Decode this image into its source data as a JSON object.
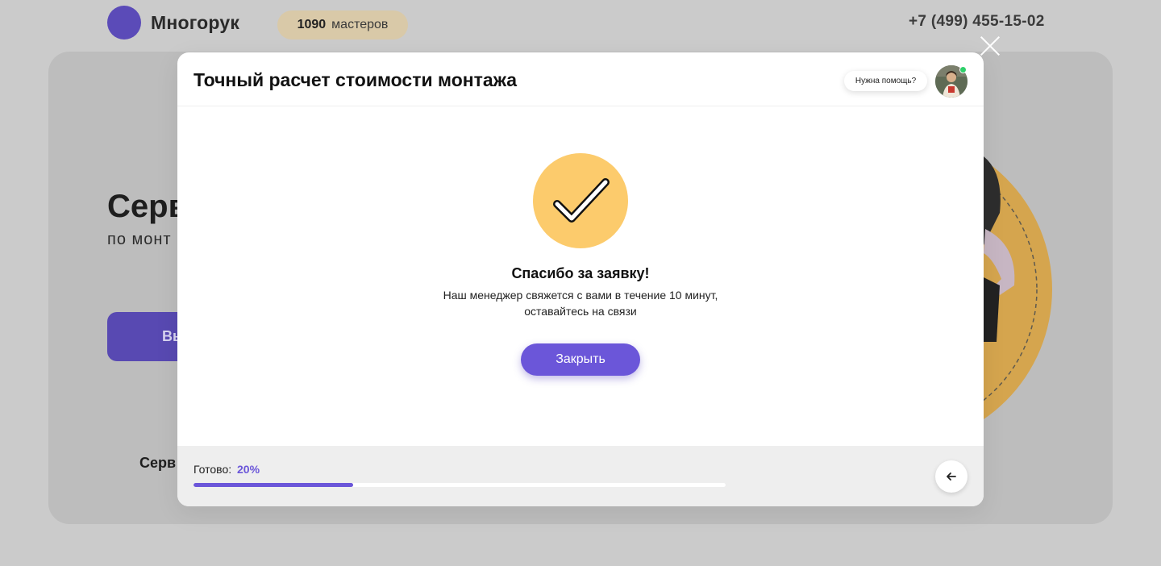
{
  "background": {
    "logo_text": "Многорук",
    "masters_count": "1090",
    "masters_label": "мастеров",
    "phone": "+7 (499) 455-15-02",
    "hero_title": "Серв",
    "hero_subtitle": "по монт",
    "hero_button": "Вы",
    "hero_small": "Серв"
  },
  "modal": {
    "title": "Точный расчет стоимости монтажа",
    "help_text": "Нужна помощь?",
    "success_title": "Спасибо за заявку!",
    "success_line1": "Наш менеджер свяжется с вами в течение 10 минут,",
    "success_line2": "оставайтесь на связи",
    "close_button": "Закрыть",
    "progress_label": "Готово:",
    "progress_value": "20%",
    "progress_fraction": 0.3
  },
  "colors": {
    "accent": "#6b56d9",
    "check_circle": "#fccb6c",
    "online": "#2fd06a",
    "overlay": "#cbcbcb"
  },
  "icons": {
    "close": "close-icon",
    "check": "checkmark-icon",
    "back": "arrow-left-icon"
  }
}
